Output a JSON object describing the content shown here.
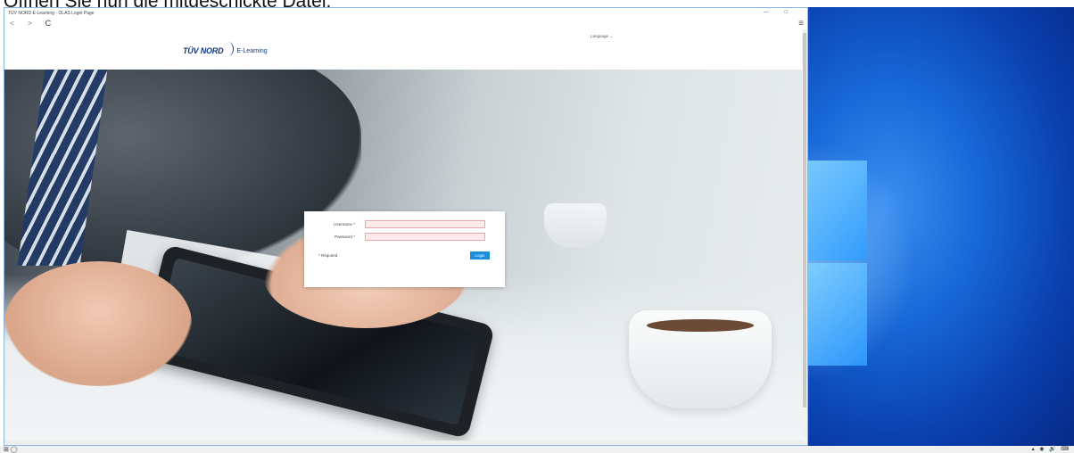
{
  "caption": "Öffnen Sie nun die mitgeschickte Datei.",
  "window": {
    "title": "TÜV NORD E-Learning - OLAS Login Page",
    "controls": "— □"
  },
  "nav": {
    "back": "<",
    "forward": ">",
    "reload": "C",
    "menu": "≡"
  },
  "header": {
    "logo_brand": "TÜV NORD",
    "logo_product": "E-Learning",
    "language": "Language ⌄"
  },
  "login": {
    "username_label": "Username *",
    "username_value": "",
    "password_label": "Password *",
    "password_value": "",
    "required_note": "* Required",
    "login_button": "Login"
  },
  "taskbar": {
    "left_icons": "⊞ ◯",
    "right_tray": "▴ ◉ 🔊 ⌨"
  },
  "colors": {
    "accent": "#1a8ddb",
    "brand": "#0d3b82",
    "input_error_bg": "#fde9ea",
    "desktop_blue": "#1768d8"
  }
}
